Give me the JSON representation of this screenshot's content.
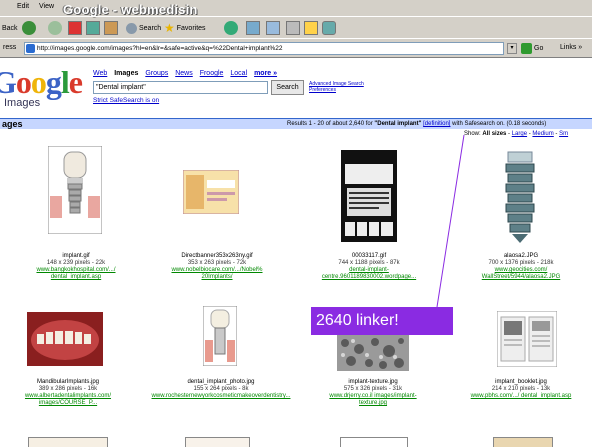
{
  "browser": {
    "menus": [
      "Edit",
      "View"
    ],
    "slide_title": "Google - webmedisin",
    "toolbar": {
      "back": "Back",
      "search": "Search",
      "favorites": "Favorites"
    },
    "address_label": "ress",
    "address_url": "http://images.google.com/images?hl=en&lr=&safe=active&q=%22Dental+implant%22",
    "go_label": "Go",
    "links_label": "Links"
  },
  "google": {
    "logo_text": "Google",
    "logo_sub": "Images",
    "tabs": [
      "Web",
      "Images",
      "Groups",
      "News",
      "Froogle",
      "Local",
      "more »"
    ],
    "query": "\"Dental implant\"",
    "search_button": "Search",
    "advanced_search": "Advanced Image Search",
    "preferences": "Preferences",
    "safesearch_link": "Strict SafeSearch is on"
  },
  "results_bar": {
    "section_title": "ages",
    "results_prefix": "Results 1 - 20 of about 2,640 for",
    "query_bold": "\"Dental implant\"",
    "definition": "[definition]",
    "results_suffix": "with Safesearch on. (0.18 seconds)",
    "show_label": "Show:",
    "show_all": "All sizes",
    "show_large": "Large",
    "show_medium": "Medium",
    "show_small": "Sm"
  },
  "images": [
    {
      "name": "implant.gif",
      "meta": "148 x 239 pixels - 22k",
      "url1": "www.bangkokhospital.com/.../",
      "url2": "dental_implant.asp"
    },
    {
      "name": "Directbanner353x263ny.gif",
      "meta": "353 x 263 pixels - 72k",
      "url1": "www.nobelbiocare.com/.../Nobel%",
      "url2": "20Implants/"
    },
    {
      "name": "00033117.gif",
      "meta": "744 x 1188 pixels - 87k",
      "url1": "dental-implant-",
      "url2": "centre.9601189830002.wordpage..."
    },
    {
      "name": "alaosa2.JPG",
      "meta": "700 x 1376 pixels - 218k",
      "url1": "www.geocities.com/",
      "url2": "WallStreet/5944/alaosa2.JPG"
    },
    {
      "name": "MandibularImplants.jpg",
      "meta": "389 x 286 pixels - 16k",
      "url1": "www.albertadentalimplants.com/",
      "url2": "images/COURSE_P..."
    },
    {
      "name": "dental_implant_photo.jpg",
      "meta": "155 x 264 pixels - 8k",
      "url1": "www.rochesternewyorkcosmeticmakeoverdentistry...",
      "url2": ""
    },
    {
      "name": "implant-texture.jpg",
      "meta": "575 x 326 pixels - 31k",
      "url1": "www.drjerry.co.il images/implant-",
      "url2": "texture.jpg"
    },
    {
      "name": "implant_booklet.jpg",
      "meta": "214 x 210 pixels - 13k",
      "url1": "www.pbhs.com/.../ dental_implant.asp",
      "url2": ""
    }
  ],
  "annotation": {
    "text": "2640 linker!"
  },
  "colors": {
    "annotation_bg": "#8a2be2",
    "results_bar": "#c6d6ff",
    "link": "#0000cc",
    "url": "#008000"
  }
}
